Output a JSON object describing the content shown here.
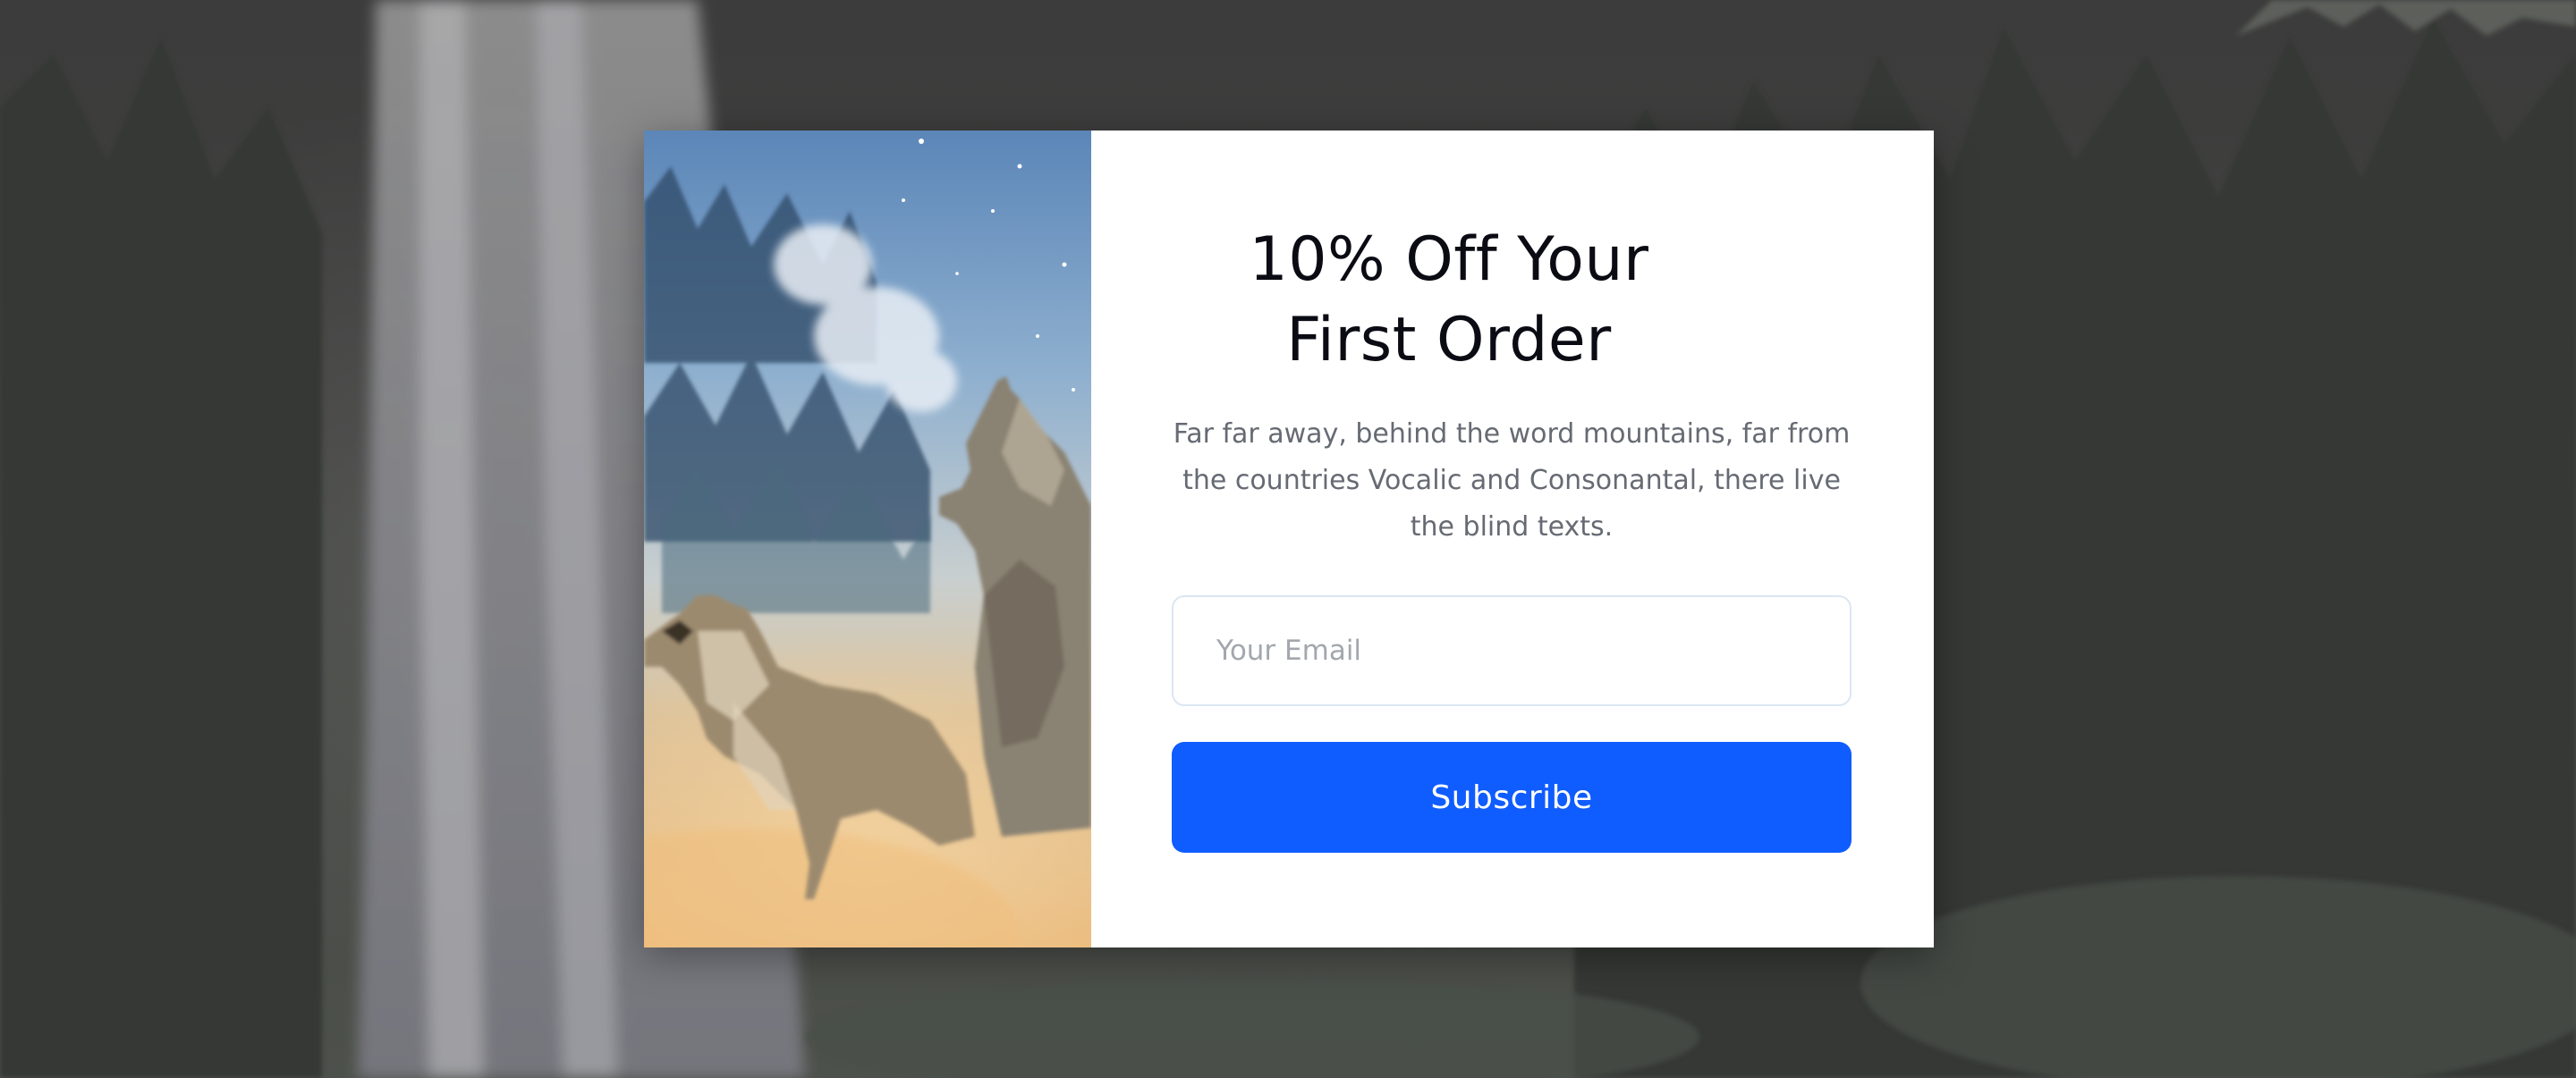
{
  "popup": {
    "title_line1": "10% Off Your",
    "title_line2": "First Order",
    "description": "Far far away, behind the word mountains, far from the countries Vocalic and Consonantal, there live the blind texts.",
    "email": {
      "value": "",
      "placeholder": "Your Email"
    },
    "subscribe_label": "Subscribe"
  },
  "colors": {
    "button": "#0f5cff",
    "title": "#0b0b14",
    "body_text": "#666a73",
    "input_border": "#dbe6f2",
    "modal_background": "#ffffff"
  },
  "images": {
    "background": "misty-forest-waterfall",
    "side": "two-wolves-howling"
  }
}
